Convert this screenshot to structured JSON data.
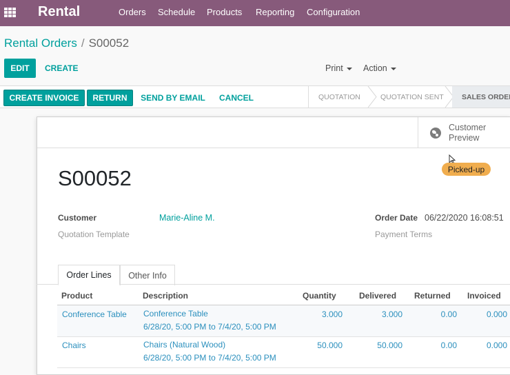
{
  "nav": {
    "brand": "Rental",
    "items": [
      "Orders",
      "Schedule",
      "Products",
      "Reporting",
      "Configuration"
    ]
  },
  "breadcrumb": {
    "parent": "Rental Orders",
    "separator": "/",
    "current": "S00052"
  },
  "controls": {
    "edit": "EDIT",
    "create": "CREATE",
    "print": "Print",
    "action": "Action"
  },
  "statusbar": {
    "create_invoice": "CREATE INVOICE",
    "return": "RETURN",
    "send_by_email": "SEND BY EMAIL",
    "cancel": "CANCEL",
    "stages": [
      "QUOTATION",
      "QUOTATION SENT",
      "SALES ORDER"
    ],
    "active_stage": "SALES ORDER"
  },
  "sheet": {
    "preview_label": "Customer Preview",
    "badge": "Picked-up",
    "title": "S00052",
    "customer_label": "Customer",
    "customer_value": "Marie-Aline M.",
    "template_label": "Quotation Template",
    "order_date_label": "Order Date",
    "order_date_value": "06/22/2020 16:08:51",
    "payment_terms_label": "Payment Terms"
  },
  "tabs": [
    "Order Lines",
    "Other Info"
  ],
  "table": {
    "headers": [
      "Product",
      "Description",
      "Quantity",
      "Delivered",
      "Returned",
      "Invoiced"
    ],
    "rows": [
      {
        "product": "Conference Table",
        "desc1": "Conference Table",
        "desc2": "6/28/20, 5:00 PM to 7/4/20, 5:00 PM",
        "quantity": "3.000",
        "delivered": "3.000",
        "returned": "0.00",
        "invoiced": "0.000"
      },
      {
        "product": "Chairs",
        "desc1": "Chairs (Natural Wood)",
        "desc2": "6/28/20, 5:00 PM to 7/4/20, 5:00 PM",
        "quantity": "50.000",
        "delivered": "50.000",
        "returned": "0.00",
        "invoiced": "0.000"
      }
    ]
  },
  "colors": {
    "nav_bg": "#875a7b",
    "primary": "#00a09d",
    "badge": "#f0ad4e",
    "link": "#2a8fbd"
  }
}
